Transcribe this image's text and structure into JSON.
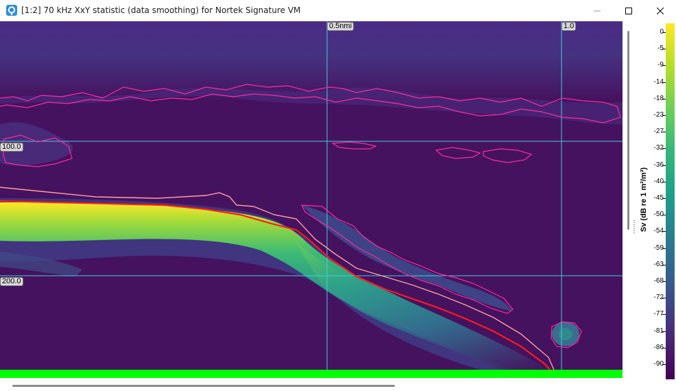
{
  "window": {
    "title": "[1:2] 70 kHz XxY statistic (data smoothing) for Nortek Signature VM",
    "icon": "app-icon",
    "controls": [
      "minimize-icon",
      "maximize-icon",
      "close-icon"
    ]
  },
  "echogram": {
    "distance_markers": [
      "0.5nmi",
      "1.0"
    ],
    "depth_markers": [
      "100.0",
      "200.0"
    ],
    "background_color": "#45125f",
    "gridline_color": "#3fd0e0",
    "region_outline_color": "#ff2aa0",
    "bottom_line_color": "#ff1a1a",
    "bottom_backstep_color": "#ffa0a0",
    "bad_data_line_color": "#00ff00"
  },
  "colorbar": {
    "label": "Sv (dB re 1 m²/m³)",
    "ticks": [
      "0",
      "-5",
      "-9",
      "-14",
      "-18",
      "-23",
      "-27",
      "-32",
      "-36",
      "-40",
      "-45",
      "-50",
      "-54",
      "-59",
      "-63",
      "-68",
      "-72",
      "-77",
      "-81",
      "-86",
      "-90"
    ]
  }
}
